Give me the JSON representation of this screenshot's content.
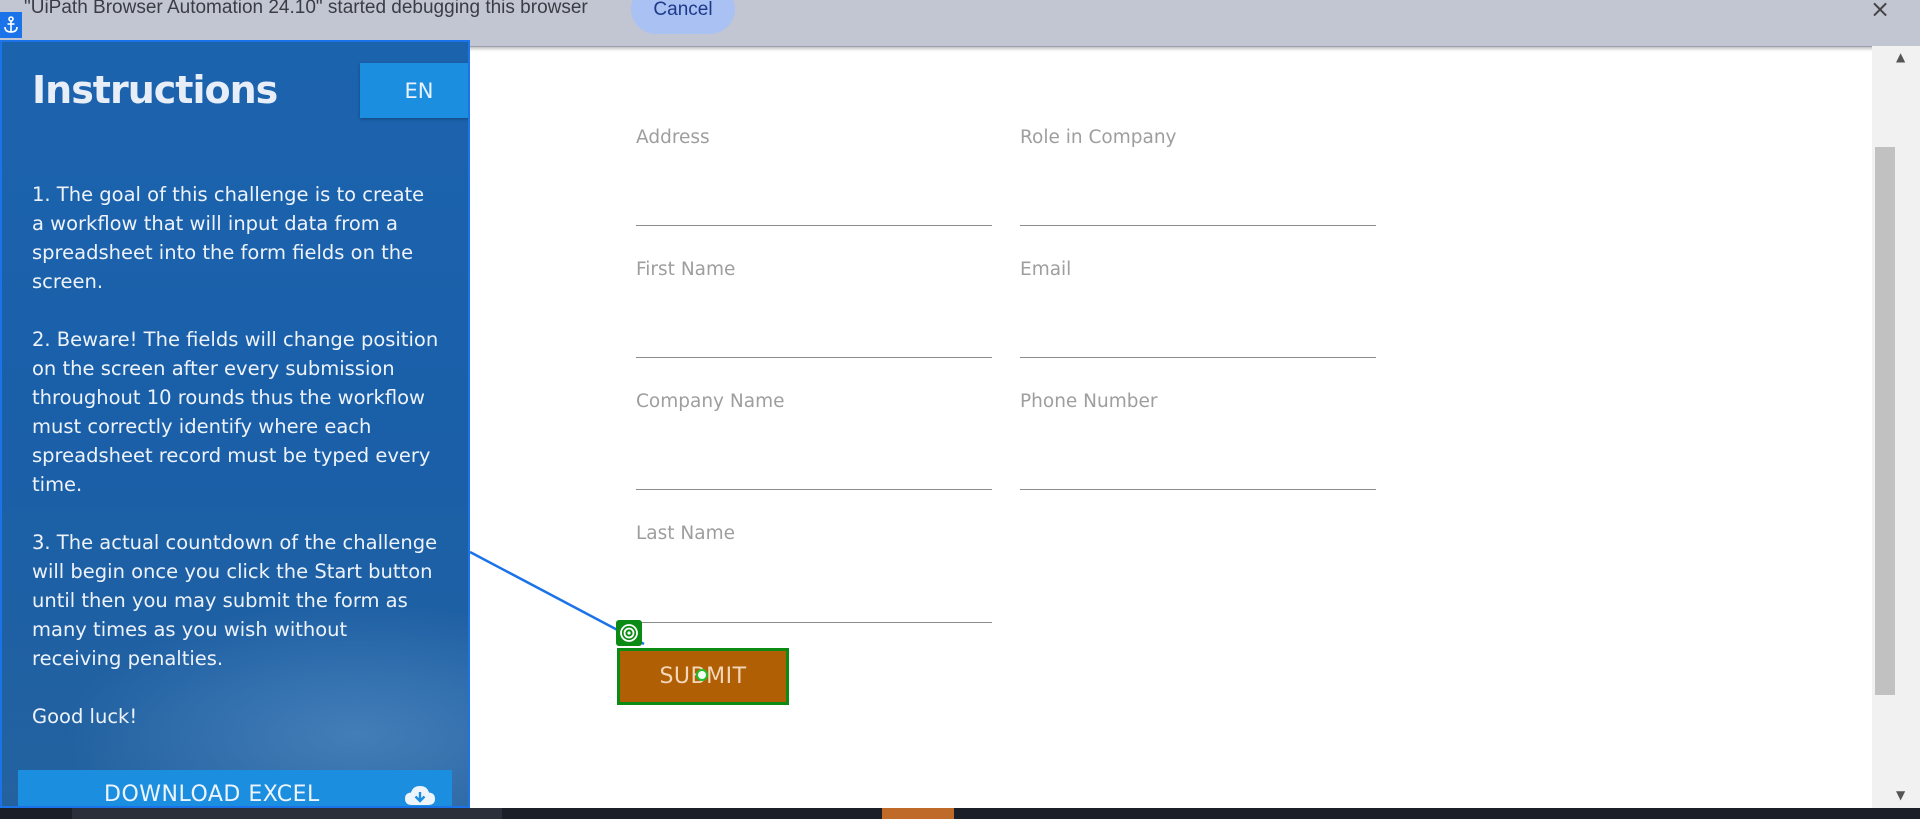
{
  "banner": {
    "message": "\"UiPath Browser Automation 24.10\" started debugging this browser",
    "cancel_label": "Cancel",
    "close_icon": "×"
  },
  "panel": {
    "title": "Instructions",
    "language": "EN",
    "instructions": [
      "1. The goal of this challenge is to create a workflow that will input data from a spreadsheet into the form fields on the screen.",
      "2. Beware! The fields will change position on the screen after every submission throughout 10 rounds thus the workflow must correctly identify where each spreadsheet record must be typed every time.",
      "3. The actual countdown of the challenge will begin once you click the Start button until then you may submit the form as many times as you wish without receiving penalties.",
      "Good luck!"
    ],
    "download_label": "DOWNLOAD EXCEL"
  },
  "form": {
    "address_label": "Address",
    "role_label": "Role in Company",
    "first_name_label": "First Name",
    "email_label": "Email",
    "company_label": "Company Name",
    "phone_label": "Phone Number",
    "last_name_label": "Last Name",
    "submit_label": "SUBMIT"
  },
  "scrollbar": {
    "up_arrow": "▲",
    "down_arrow": "▼"
  },
  "colors": {
    "panel_blue": "#1c63ae",
    "button_blue": "#1b8ee0",
    "submit_orange": "#b15f05",
    "highlight_green": "#0b8a14",
    "debug_blue": "#1a73e8"
  }
}
